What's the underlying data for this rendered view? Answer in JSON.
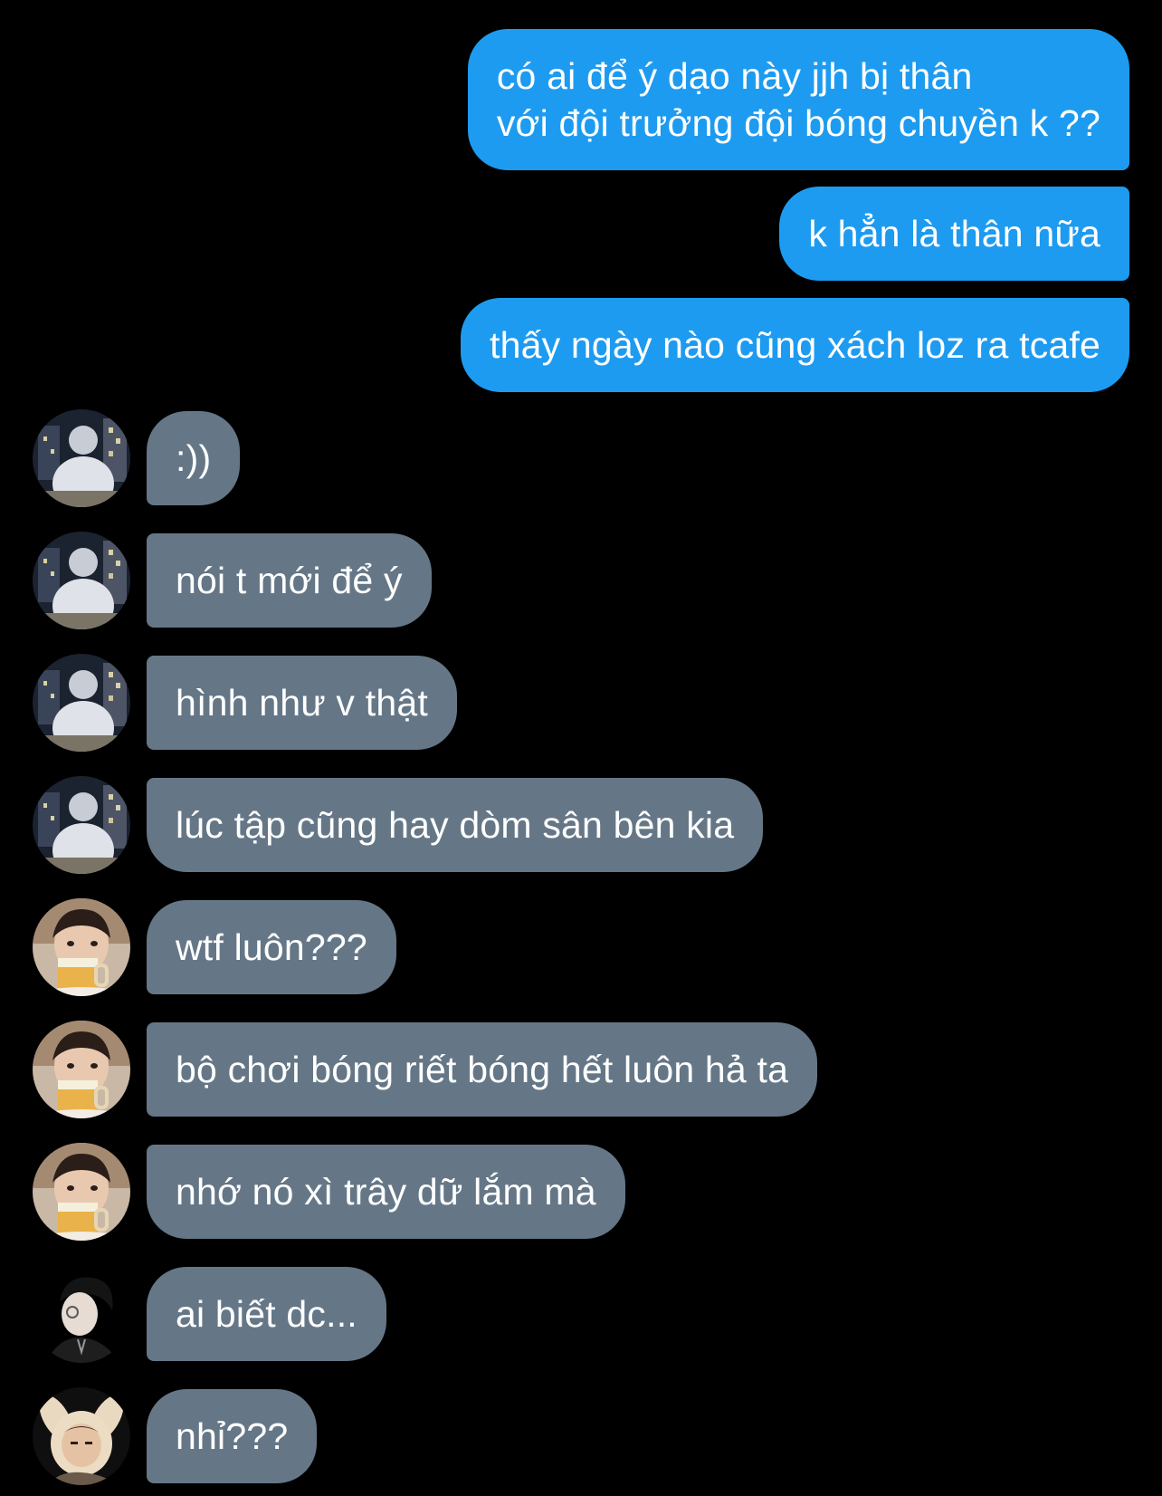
{
  "colors": {
    "background": "#000000",
    "outgoing_bubble": "#1d9bf0",
    "incoming_bubble": "#657787",
    "text": "#ffffff"
  },
  "messages": [
    {
      "direction": "outgoing",
      "text": "có ai để ý dạo này jjh bị thân\nvới đội trưởng đội bóng chuyền k ??"
    },
    {
      "direction": "outgoing",
      "text": "k hẳn là thân nữa"
    },
    {
      "direction": "outgoing",
      "text": "thấy ngày nào cũng xách loz ra tcafe"
    },
    {
      "direction": "incoming",
      "avatar": "night-street-avatar-icon",
      "text": ":))"
    },
    {
      "direction": "incoming",
      "avatar": "night-street-avatar-icon",
      "text": "nói t mới để ý"
    },
    {
      "direction": "incoming",
      "avatar": "night-street-avatar-icon",
      "text": "hình như v thật"
    },
    {
      "direction": "incoming",
      "avatar": "night-street-avatar-icon",
      "text": "lúc tập cũng hay dòm sân bên kia"
    },
    {
      "direction": "incoming",
      "avatar": "beer-boy-avatar-icon",
      "text": "wtf luôn???"
    },
    {
      "direction": "incoming",
      "avatar": "beer-boy-avatar-icon",
      "text": "bộ chơi bóng riết bóng hết luôn hả ta"
    },
    {
      "direction": "incoming",
      "avatar": "beer-boy-avatar-icon",
      "text": "nhớ nó xì trây dữ lắm mà"
    },
    {
      "direction": "incoming",
      "avatar": "glasses-boy-avatar-icon",
      "text": "ai biết dc..."
    },
    {
      "direction": "incoming",
      "avatar": "bunny-hat-avatar-icon",
      "text": "nhỉ???"
    }
  ]
}
